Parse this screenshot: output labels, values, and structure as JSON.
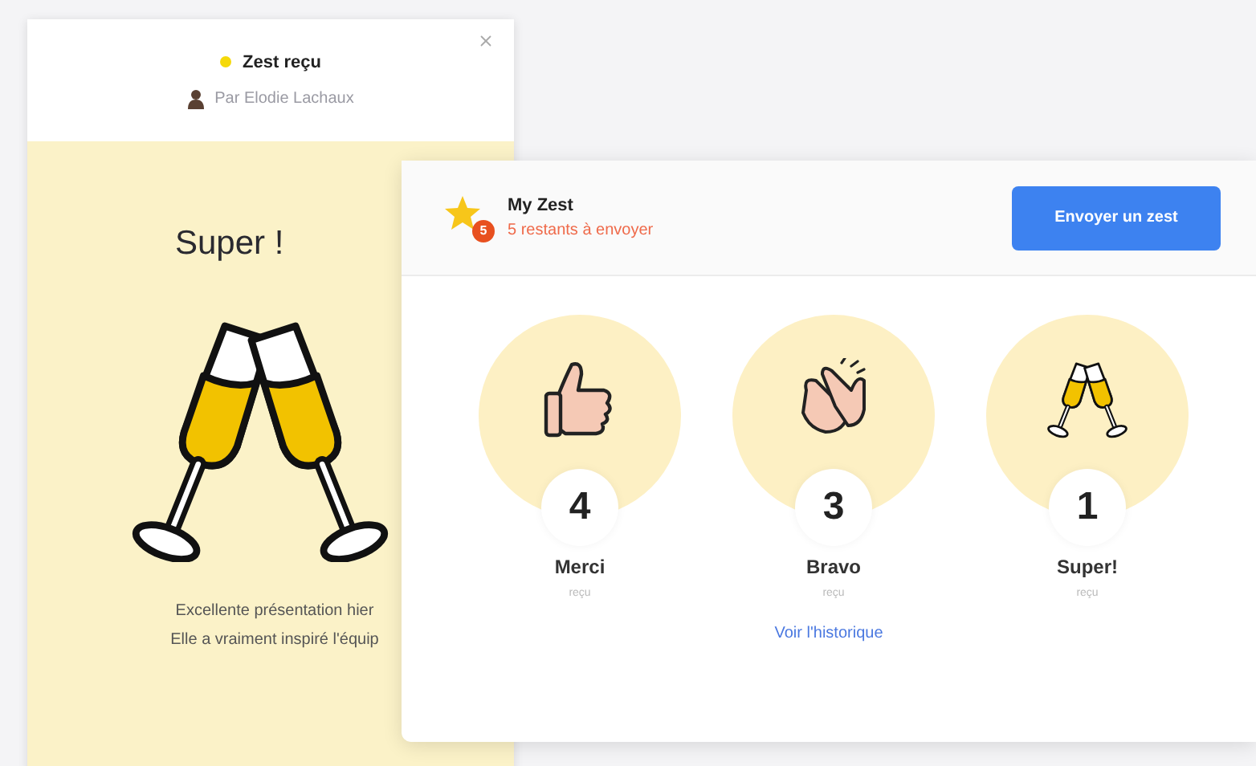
{
  "received_card": {
    "title": "Zest reçu",
    "sender": "Par Elodie Lachaux",
    "heading": "Super !",
    "message_lines": [
      "Excellente présentation hier",
      "Elle a vraiment inspiré l'équip"
    ]
  },
  "zest_panel": {
    "title": "My Zest",
    "badge": "5",
    "remaining": "5 restants à envoyer",
    "send_button": "Envoyer un zest",
    "counters": [
      {
        "kind": "thumbs",
        "count": "4",
        "label": "Merci",
        "caption": "reçu"
      },
      {
        "kind": "clap",
        "count": "3",
        "label": "Bravo",
        "caption": "reçu"
      },
      {
        "kind": "cheers",
        "count": "1",
        "label": "Super!",
        "caption": "reçu"
      }
    ],
    "history_link": "Voir l'historique"
  }
}
